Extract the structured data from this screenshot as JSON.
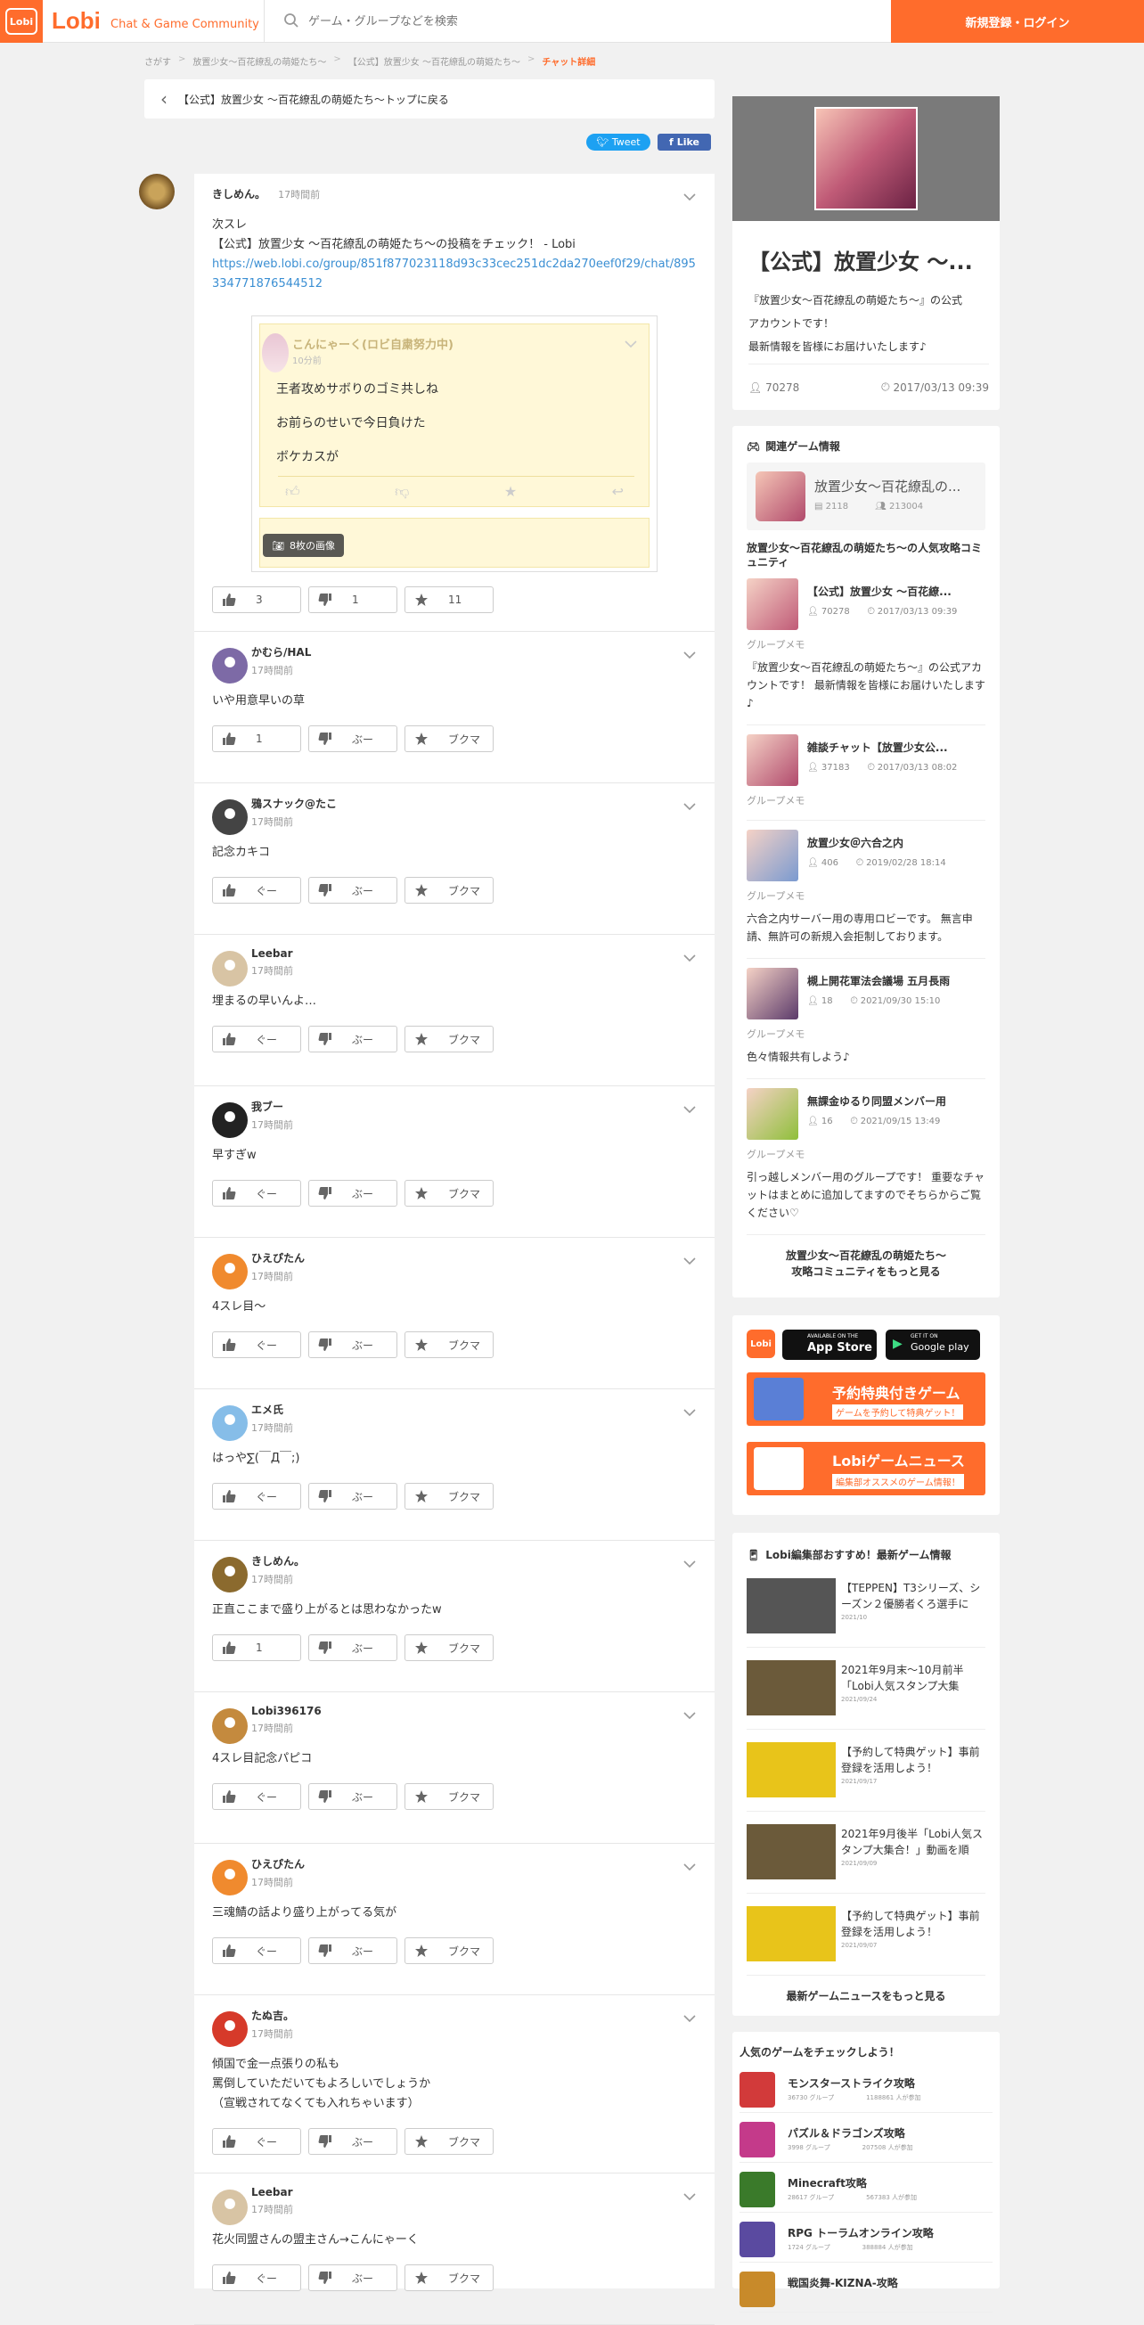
{
  "header": {
    "logo_box": "Lobi",
    "logo_text": "Lobi",
    "tagline": "Chat & Game Community",
    "search_placeholder": "ゲーム・グループなどを検索",
    "login_label": "新規登録・ログイン",
    "accent": "#ff6c2c"
  },
  "breadcrumb": [
    "さがす",
    "放置少女〜百花繚乱の萌姫たち〜",
    "【公式】放置少女 〜百花繚乱の萌姫たち〜",
    "チャット詳細"
  ],
  "back_link": "【公式】放置少女 〜百花繚乱の萌姫たち〜トップに戻る",
  "share": {
    "tweet": "Tweet",
    "like": "Like"
  },
  "first_post": {
    "name": "きしめん。",
    "time": "17時間前",
    "body_line1": "次スレ",
    "body_line2": "【公式】放置少女 〜百花繚乱の萌姫たち〜の投稿をチェック！ - Lobi",
    "link": "https://web.lobi.co/group/851f877023118d93c33cec251dc2da270eef0f29/chat/895334771876544512",
    "embed": {
      "name": "こんにゃーく(ロビ自粛努力中)",
      "time": "10分前",
      "lines": [
        "王者攻めサボりのゴミ共しね",
        "お前らのせいで今日負けた",
        "ボケカスが"
      ],
      "images_badge": "8枚の画像"
    },
    "good": "3",
    "boo": "1",
    "bookmark": "11"
  },
  "replies": [
    {
      "name": "かむら/HAL",
      "time": "17時間前",
      "body": [
        "いや用意早いの草"
      ],
      "good": "1",
      "boo": "ぶー",
      "bm": "ブクマ",
      "av": "#7d6aa6"
    },
    {
      "name": "鴉スナック@たこ",
      "time": "17時間前",
      "body": [
        "記念カキコ"
      ],
      "good": "ぐー",
      "boo": "ぶー",
      "bm": "ブクマ",
      "av": "#444444"
    },
    {
      "name": "Leebar",
      "time": "17時間前",
      "body": [
        "埋まるの早いんよ…"
      ],
      "good": "ぐー",
      "boo": "ぶー",
      "bm": "ブクマ",
      "av": "#d8c4a4"
    },
    {
      "name": "我ブー",
      "time": "17時間前",
      "body": [
        "早すぎw"
      ],
      "good": "ぐー",
      "boo": "ぶー",
      "bm": "ブクマ",
      "av": "#222222"
    },
    {
      "name": "ひえぴたん",
      "time": "17時間前",
      "body": [
        "4スレ目〜"
      ],
      "good": "ぐー",
      "boo": "ぶー",
      "bm": "ブクマ",
      "av": "#f08a2e"
    },
    {
      "name": "エメ氏",
      "time": "17時間前",
      "body": [
        "はっや∑(￣Д￣;)"
      ],
      "good": "ぐー",
      "boo": "ぶー",
      "bm": "ブクマ",
      "av": "#86bde8"
    },
    {
      "name": "きしめん。",
      "time": "17時間前",
      "body": [
        "正直ここまで盛り上がるとは思わなかったw"
      ],
      "good": "1",
      "boo": "ぶー",
      "bm": "ブクマ",
      "av": "#8b6a2e"
    },
    {
      "name": "Lobi396176",
      "time": "17時間前",
      "body": [
        "4スレ目記念パピコ"
      ],
      "good": "ぐー",
      "boo": "ぶー",
      "bm": "ブクマ",
      "av": "#c48a3e"
    },
    {
      "name": "ひえぴたん",
      "time": "17時間前",
      "body": [
        "三魂鯖の話より盛り上がってる気が"
      ],
      "good": "ぐー",
      "boo": "ぶー",
      "bm": "ブクマ",
      "av": "#f08a2e"
    },
    {
      "name": "たぬ吉。",
      "time": "17時間前",
      "body": [
        "傾国で金一点張りの私も",
        "罵倒していただいてもよろしいでしょうか",
        "（宣戦されてなくても入れちゃいます）"
      ],
      "good": "ぐー",
      "boo": "ぶー",
      "bm": "ブクマ",
      "av": "#d63a2a"
    },
    {
      "name": "Leebar",
      "time": "17時間前",
      "body": [
        "花火同盟さんの盟主さん→こんにゃーく"
      ],
      "good": "ぐー",
      "boo": "ぶー",
      "bm": "ブクマ",
      "av": "#d8c4a4"
    }
  ],
  "group_card": {
    "title": "【公式】放置少女 〜...",
    "desc": [
      "『放置少女〜百花繚乱の萌姫たち〜』の公式",
      "アカウントです！",
      "最新情報を皆様にお届けいたします♪"
    ],
    "members": "70278",
    "date": "2017/03/13 09:39"
  },
  "related": {
    "heading": "関連ゲーム情報",
    "game_name": "放置少女〜百花繚乱の...",
    "game_groups": "2118",
    "game_users": "213004",
    "comm_title": "放置少女〜百花繚乱の萌姫たち〜の人気攻略コミュニティ",
    "communities": [
      {
        "name": "【公式】放置少女 〜百花繚...",
        "members": "70278",
        "date": "2017/03/13 09:39",
        "label": "グループメモ",
        "desc": "『放置少女〜百花繚乱の萌姫たち〜』の公式アカウントです！ 最新情報を皆様にお届けいたします♪",
        "c": "#c05b77"
      },
      {
        "name": "雑談チャット【放置少女公...",
        "members": "37183",
        "date": "2017/03/13 08:02",
        "label": "グループメモ",
        "desc": "",
        "c": "#b14a6c"
      },
      {
        "name": "放置少女＠六合之内",
        "members": "406",
        "date": "2019/02/28 18:14",
        "label": "グループメモ",
        "desc": "六合之内サーバー用の専用ロビーです。 無言申請、無許可の新規入会拒制しております。",
        "c": "#7a9ad0"
      },
      {
        "name": "槻上開花軍法会議場 五月長雨",
        "members": "18",
        "date": "2021/09/30 15:10",
        "label": "グループメモ",
        "desc": "色々情報共有しよう♪",
        "c": "#5b3a6a"
      },
      {
        "name": "無課金ゆるり同盟メンバー用",
        "members": "16",
        "date": "2021/09/15 13:49",
        "label": "グループメモ",
        "desc": "引っ越しメンバー用のグループです！ 重要なチャットはまとめに追加してますのでそちらからご覧ください♡",
        "c": "#8fbf3a"
      }
    ],
    "more": [
      "放置少女〜百花繚乱の萌姫たち〜",
      "攻略コミュニティをもっと見る"
    ]
  },
  "apps": {
    "appstore_small": "AVAILABLE ON THE",
    "appstore": "App Store",
    "gplay_small": "GET IT ON",
    "gplay": "Google play",
    "banner1_title": "予約特典付きゲーム",
    "banner1_sub": "ゲームを予約して特典ゲット！",
    "banner2_title": "Lobiゲームニュース",
    "banner2_sub": "編集部オススメのゲーム情報！"
  },
  "news": {
    "heading": "Lobi編集部おすすめ！最新ゲーム情報",
    "items": [
      {
        "text": "【TEPPEN】T3シリーズ、シーズン２優勝者くろ選手に",
        "date": "2021/10",
        "c": "#555555"
      },
      {
        "text": "2021年9月末〜10月前半「Lobi人気スタンプ大集",
        "date": "2021/09/24",
        "c": "#6b5a3a"
      },
      {
        "text": "【予約して特典ゲット】事前登録を活用しよう！",
        "date": "2021/09/17",
        "c": "#e8c41a"
      },
      {
        "text": "2021年9月後半「Lobi人気スタンプ大集合！」動画を順",
        "date": "2021/09/09",
        "c": "#6b5a3a"
      },
      {
        "text": "【予約して特典ゲット】事前登録を活用しよう！",
        "date": "2021/09/07",
        "c": "#e8c41a"
      }
    ],
    "more": "最新ゲームニュースをもっと見る"
  },
  "popular": {
    "heading": "人気のゲームをチェックしよう！",
    "items": [
      {
        "name": "モンスターストライク攻略",
        "groups": "36730 グループ",
        "users": "1188861 人が参加",
        "c": "#d23a3a"
      },
      {
        "name": "パズル＆ドラゴンズ攻略",
        "groups": "3998 グループ",
        "users": "207508 人が参加",
        "c": "#c43a8a"
      },
      {
        "name": "Minecraft攻略",
        "groups": "28617 グループ",
        "users": "567383 人が参加",
        "c": "#3a7a2a"
      },
      {
        "name": "RPG トーラムオンライン攻略",
        "groups": "1724 グループ",
        "users": "388884 人が参加",
        "c": "#5a4aa0"
      },
      {
        "name": "戦国炎舞-KIZNA-攻略",
        "groups": "",
        "users": "",
        "c": "#c88a2a"
      }
    ]
  }
}
